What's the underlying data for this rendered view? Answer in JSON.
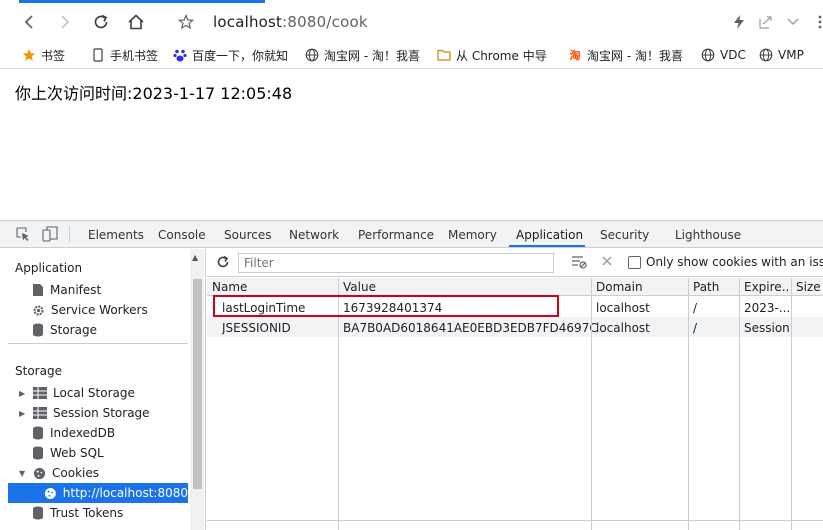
{
  "browser": {
    "url_host": "localhost",
    "url_rest": ":8080/cook"
  },
  "bookmarks": [
    {
      "label": "书签",
      "icon": "star-icon",
      "color": "#f29900"
    },
    {
      "label": "手机书签",
      "icon": "phone-icon"
    },
    {
      "label": "百度一下，你就知",
      "icon": "baidu-paw-icon",
      "color": "#2932e1"
    },
    {
      "label": "淘宝网 - 淘！我喜",
      "icon": "globe-icon"
    },
    {
      "label": "从 Chrome 中导",
      "icon": "folder-icon",
      "color": "#f9ab00"
    },
    {
      "label": "淘宝网 - 淘！我喜",
      "icon": "taobao-icon",
      "color": "#ff5000"
    },
    {
      "label": "VDC",
      "icon": "globe-icon"
    },
    {
      "label": "VMP",
      "icon": "globe-icon"
    }
  ],
  "page": {
    "visit_text": "你上次访问时间:2023-1-17 12:05:48"
  },
  "devtools": {
    "tabs": [
      "Elements",
      "Console",
      "Sources",
      "Network",
      "Performance",
      "Memory",
      "Application",
      "Security",
      "Lighthouse"
    ],
    "active_tab": "Application",
    "accent": "#1a73e8",
    "sidebar": {
      "application_head": "Application",
      "application_items": [
        "Manifest",
        "Service Workers",
        "Storage"
      ],
      "storage_head": "Storage",
      "storage_items": [
        "Local Storage",
        "Session Storage",
        "IndexedDB",
        "Web SQL",
        "Cookies"
      ],
      "cookie_origin": "http://localhost:8080",
      "trust_tokens": "Trust Tokens"
    },
    "filter": {
      "placeholder": "Filter",
      "only_issues_label": "Only show cookies with an issue"
    },
    "columns": [
      "Name",
      "Value",
      "Domain",
      "Path",
      "Expire...",
      "Size"
    ],
    "cookies": [
      {
        "name": "lastLoginTime",
        "value": "1673928401374",
        "domain": "localhost",
        "path": "/",
        "expires": "2023-..."
      },
      {
        "name": "JSESSIONID",
        "value": "BA7B0AD6018641AE0EBD3EDB7FD4697C",
        "domain": "localhost",
        "path": "/",
        "expires": "Session"
      }
    ],
    "highlight_color": "#d0021b"
  }
}
